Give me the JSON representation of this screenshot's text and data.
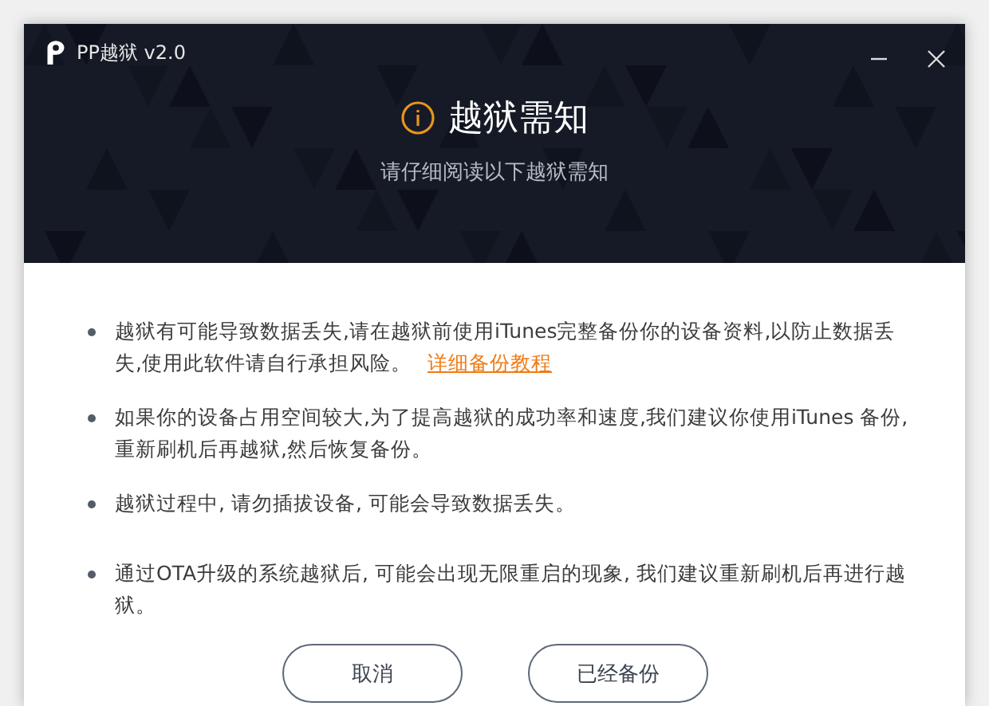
{
  "window": {
    "title": "PP越狱 v2.0"
  },
  "header": {
    "title": "越狱需知",
    "subtitle": "请仔细阅读以下越狱需知"
  },
  "notices": [
    {
      "text": "越狱有可能导致数据丢失,请在越狱前使用iTunes完整备份你的设备资料,以防止数据丢失,使用此软件请自行承担风险。",
      "link": "详细备份教程"
    },
    {
      "text": "如果你的设备占用空间较大,为了提高越狱的成功率和速度,我们建议你使用iTunes 备份,重新刷机后再越狱,然后恢复备份。"
    },
    {
      "text": "越狱过程中, 请勿插拔设备, 可能会导致数据丢失。"
    },
    {
      "text": "通过OTA升级的系统越狱后, 可能会出现无限重启的现象, 我们建议重新刷机后再进行越狱。"
    }
  ],
  "buttons": [
    "取消",
    "已经备份"
  ]
}
